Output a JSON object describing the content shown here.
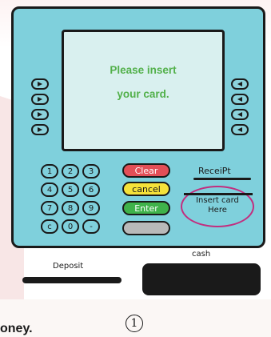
{
  "colors": {
    "body": "#7fd0dc",
    "screen": "#d9f0ef",
    "screen_text": "#52b04a",
    "clear": "#e24f57",
    "cancel": "#f5e23a",
    "enter": "#3fb24a",
    "circle": "#c22e7f"
  },
  "screen": {
    "line1": "Please insert",
    "line2": "your card."
  },
  "side_buttons": {
    "left_icon": "chevron-right-icon",
    "right_icon": "chevron-left-icon"
  },
  "keypad": {
    "keys": [
      "1",
      "2",
      "3",
      "4",
      "5",
      "6",
      "7",
      "8",
      "9",
      "c",
      "0",
      "-"
    ]
  },
  "function_buttons": {
    "clear": "Clear",
    "cancel": "cancel",
    "enter": "Enter"
  },
  "labels": {
    "receipt": "ReceiPt",
    "insert_card_line1": "Insert card",
    "insert_card_line2": "Here",
    "deposit": "Deposit",
    "cash": "cash"
  },
  "page": {
    "number": "1",
    "caption_fragment": "oney."
  }
}
